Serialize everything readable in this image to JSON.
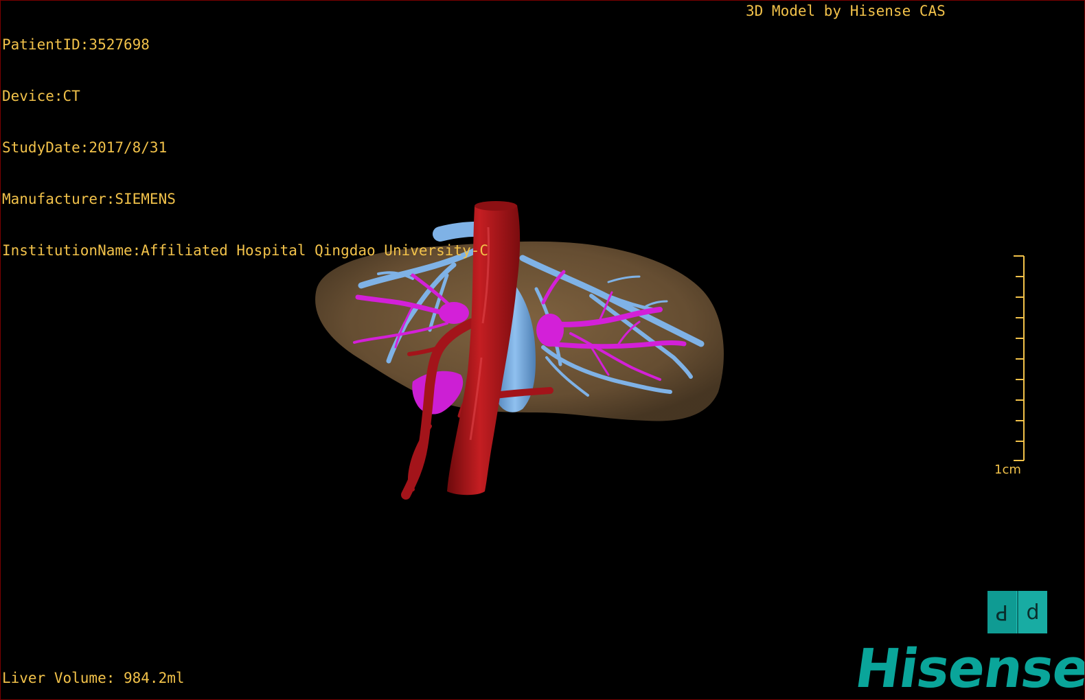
{
  "patient_info": {
    "patient_id": "PatientID:3527698",
    "device": "Device:CT",
    "study_date": "StudyDate:2017/8/31",
    "manufacturer": "Manufacturer:SIEMENS",
    "institution": "InstitutionName:Affiliated Hospital Qingdao University-C"
  },
  "credit": "3D Model by Hisense CAS",
  "measurements": {
    "liver_volume": "Liver Volume: 984.2ml"
  },
  "scale_bar": {
    "label": "1cm"
  },
  "orientation_cube": {
    "left_face": "P",
    "right_face": "d"
  },
  "brand": {
    "logo_text": "Hisense"
  },
  "colors": {
    "overlay_text": "#f2c24a",
    "liver": "#6e5436",
    "artery": "#b3171b",
    "portal_vein": "#7fb2e6",
    "hepatic_vein": "#d320d8",
    "brand": "#0aa59a"
  }
}
